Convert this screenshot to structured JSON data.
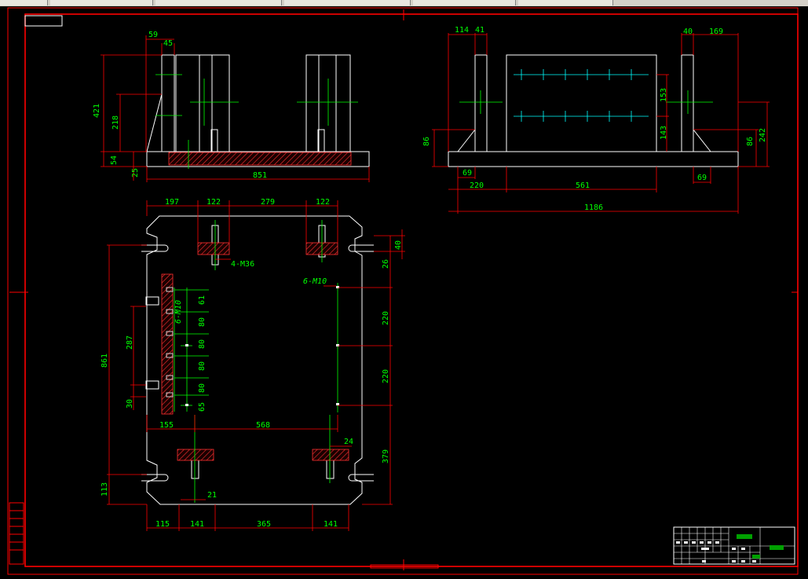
{
  "colors": {
    "background": "#000000",
    "frame": "#ff0000",
    "outline": "#ffffff",
    "dimension": "#00ff00",
    "center_line": "#00ffff",
    "hatch": "#ff3030"
  },
  "front_view": {
    "dims": {
      "d59": "59",
      "d45": "45",
      "d421": "421",
      "d218": "218",
      "d54": "54",
      "d25": "25",
      "d851": "851"
    }
  },
  "side_view": {
    "dims": {
      "d114": "114",
      "d41": "41",
      "d40": "40",
      "d169": "169",
      "d153": "153",
      "d143": "143",
      "d86l": "86",
      "d86r": "86",
      "d242": "242",
      "d69l": "69",
      "d69r": "69",
      "d220": "220",
      "d561": "561",
      "d1186": "1186"
    }
  },
  "plan_view": {
    "dims": {
      "d197": "197",
      "d122a": "122",
      "d279": "279",
      "d122b": "122",
      "d40": "40",
      "d26": "26",
      "d220a": "220",
      "d220b": "220",
      "d379": "379",
      "d861": "861",
      "d287": "287",
      "d30": "30",
      "d113": "113",
      "d155": "155",
      "d568": "568",
      "d24": "24",
      "d21": "21",
      "d115": "115",
      "d141a": "141",
      "d365": "365",
      "d141b": "141",
      "d61": "61",
      "d80a": "80",
      "d80b": "80",
      "d80c": "80",
      "d80d": "80",
      "d65": "65"
    },
    "callouts": {
      "bolt_m36": "4-M36",
      "bolt_m10_right": "6-M10",
      "bolt_m10_left": "6-M10"
    }
  }
}
